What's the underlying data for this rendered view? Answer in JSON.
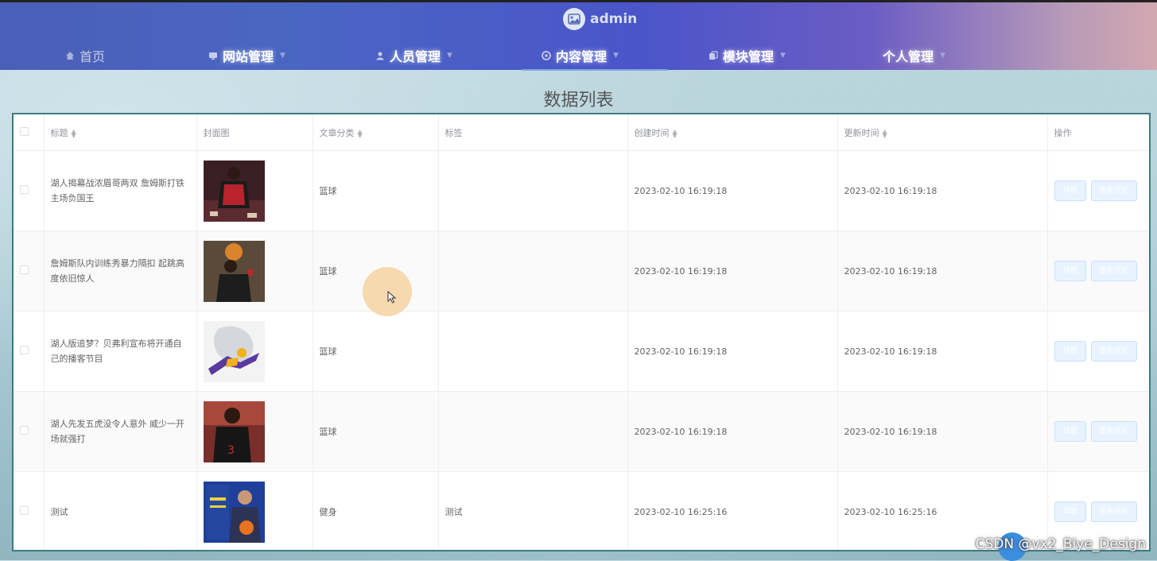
{
  "header": {
    "username": "admin",
    "nav": [
      {
        "label": "首页",
        "icon": "home-icon",
        "has_caret": false
      },
      {
        "label": "网站管理",
        "icon": "monitor-icon",
        "has_caret": true
      },
      {
        "label": "人员管理",
        "icon": "user-icon",
        "has_caret": true
      },
      {
        "label": "内容管理",
        "icon": "content-icon",
        "has_caret": true
      },
      {
        "label": "模块管理",
        "icon": "module-icon",
        "has_caret": true
      },
      {
        "label": "个人管理",
        "icon": "",
        "has_caret": true
      }
    ],
    "active_nav": "内容管理"
  },
  "page": {
    "title": "数据列表"
  },
  "table": {
    "columns": [
      "标题",
      "封面图",
      "文章分类",
      "标签",
      "创建时间",
      "更新时间",
      "操作"
    ],
    "sortable": [
      true,
      false,
      true,
      false,
      true,
      true,
      false
    ],
    "rows": [
      {
        "title": "湖人揭幕战浓眉哥两双 詹姆斯打铁主场负国王",
        "category": "篮球",
        "tag": "",
        "created": "2023-02-10 16:19:18",
        "updated": "2023-02-10 16:19:18",
        "btn_detail": "详情",
        "btn_view": "查看评论"
      },
      {
        "title": "詹姆斯队内训练秀暴力隔扣 起跳高度依旧惊人",
        "category": "篮球",
        "tag": "",
        "created": "2023-02-10 16:19:18",
        "updated": "2023-02-10 16:19:18",
        "btn_detail": "详情",
        "btn_view": "查看评论"
      },
      {
        "title": "湖人版追梦？贝弗利宣布将开通自己的播客节目",
        "category": "篮球",
        "tag": "",
        "created": "2023-02-10 16:19:18",
        "updated": "2023-02-10 16:19:18",
        "btn_detail": "详情",
        "btn_view": "查看评论"
      },
      {
        "title": "湖人先发五虎没令人意外 威少一开场就强打",
        "category": "篮球",
        "tag": "",
        "created": "2023-02-10 16:19:18",
        "updated": "2023-02-10 16:19:18",
        "btn_detail": "详情",
        "btn_view": "查看评论"
      },
      {
        "title": "测试",
        "category": "健身",
        "tag": "测试",
        "created": "2023-02-10 16:25:16",
        "updated": "2023-02-10 16:25:16",
        "btn_detail": "详情",
        "btn_view": "查看评论"
      }
    ]
  },
  "watermark": "CSDN @vx2_Biye_Design",
  "colors": {
    "header_start": "#4a5fb7",
    "header_end": "#d2a8b0",
    "table_border": "#3f7a80",
    "button_bg": "#e8f3ff"
  }
}
